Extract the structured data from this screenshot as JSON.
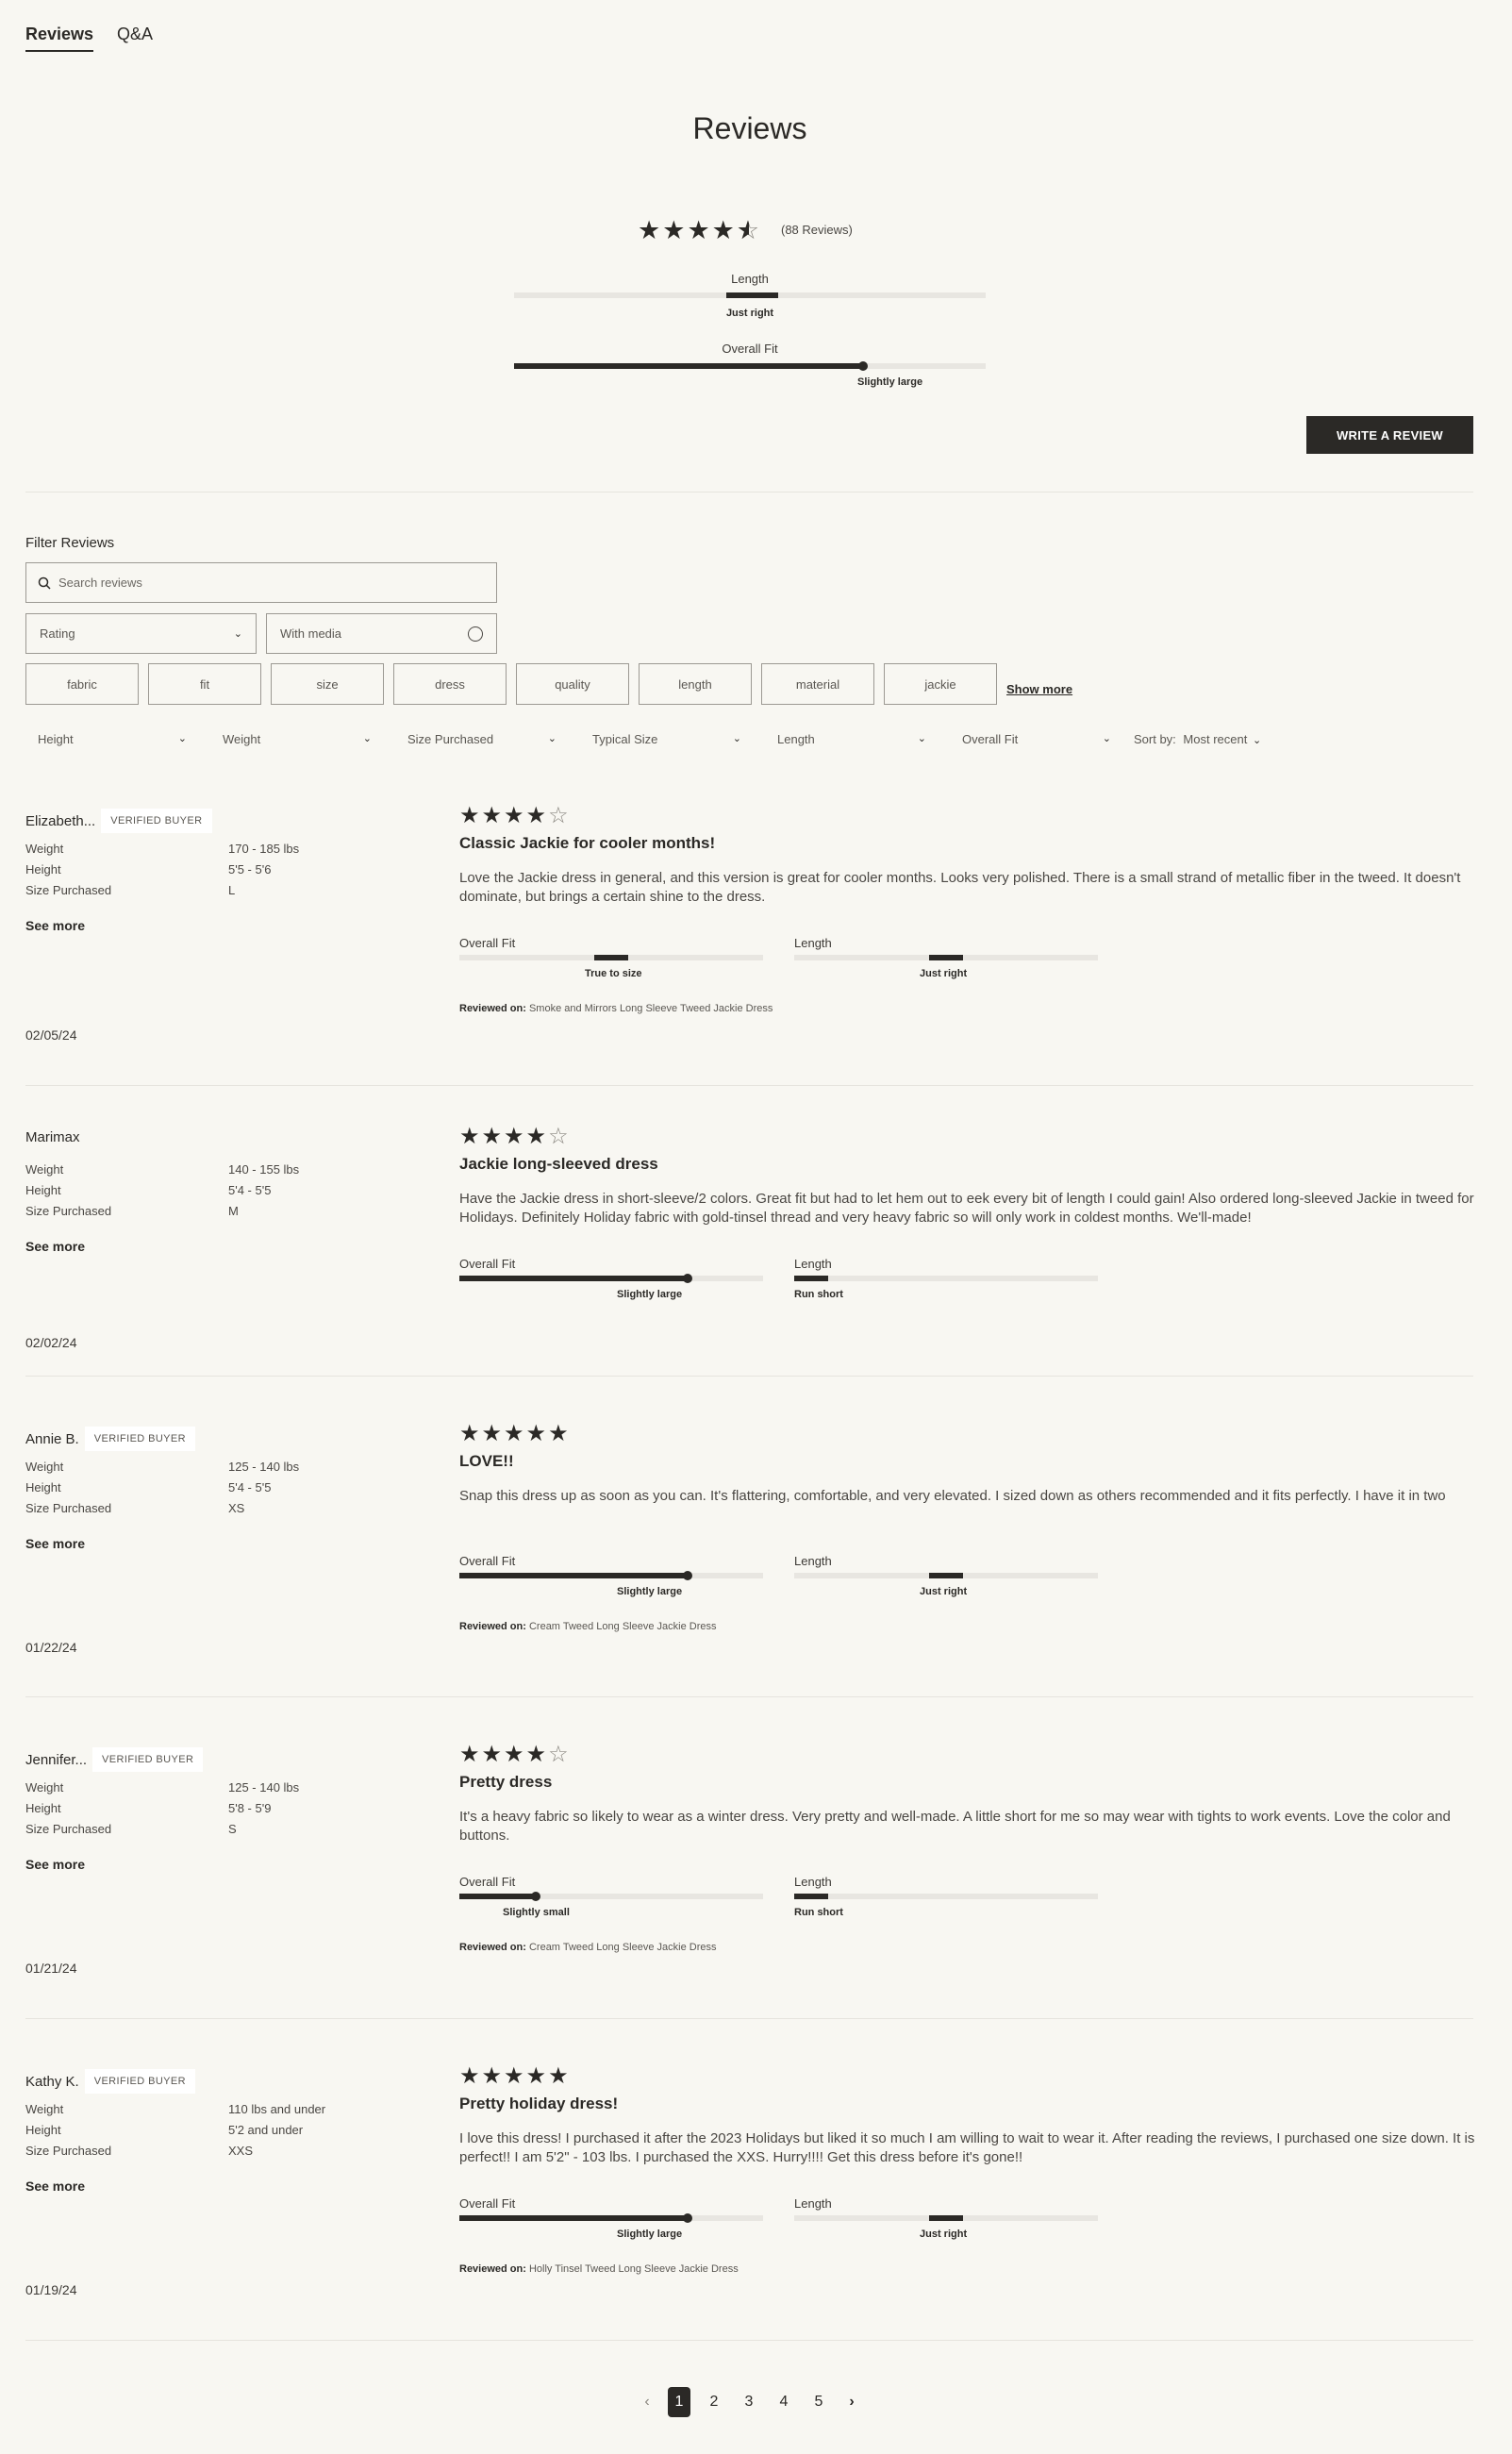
{
  "tabs": [
    {
      "label": "Reviews",
      "active": true
    },
    {
      "label": "Q&A",
      "active": false
    }
  ],
  "page_title": "Reviews",
  "summary": {
    "rating": 4.5,
    "count_label": "(88 Reviews)",
    "length": {
      "label": "Length",
      "value": "Just right",
      "level": 0.5
    },
    "overall_fit": {
      "label": "Overall Fit",
      "value": "Slightly large",
      "level": 0.74
    }
  },
  "write_review_label": "WRITE A REVIEW",
  "filters": {
    "title": "Filter Reviews",
    "search_placeholder": "Search reviews",
    "rating_label": "Rating",
    "media_label": "With media",
    "chips": [
      "fabric",
      "fit",
      "size",
      "dress",
      "quality",
      "length",
      "material",
      "jackie"
    ],
    "show_more": "Show more",
    "dropdowns": [
      "Height",
      "Weight",
      "Size Purchased",
      "Typical Size",
      "Length",
      "Overall Fit"
    ],
    "sort_label": "Sort by:",
    "sort_value": "Most recent"
  },
  "attr_labels": {
    "weight": "Weight",
    "height": "Height",
    "size": "Size Purchased"
  },
  "see_more": "See more",
  "meter_labels": {
    "fit": "Overall Fit",
    "length": "Length"
  },
  "reviewed_on_label": "Reviewed on:",
  "reviews": [
    {
      "name": "Elizabeth...",
      "verified": "VERIFIED BUYER",
      "weight": "170 - 185 lbs",
      "height": "5'5 - 5'6",
      "size": "L",
      "date": "02/05/24",
      "rating": 4,
      "title": "Classic Jackie for cooler months!",
      "body": "Love the Jackie dress in general, and this version is great for cooler months. Looks very polished. There is a small strand of metallic fiber in the tweed. It doesn't dominate, but brings a certain shine to the dress.",
      "fit_value": "True to size",
      "fit_level": 0.5,
      "length_value": "Just right",
      "length_level": 0.5,
      "product": "Smoke and Mirrors Long Sleeve Tweed Jackie Dress"
    },
    {
      "name": "Marimax",
      "verified": "",
      "weight": "140 - 155 lbs",
      "height": "5'4 - 5'5",
      "size": "M",
      "date": "02/02/24",
      "rating": 4,
      "title": "Jackie long-sleeved dress",
      "body": "Have the Jackie dress in short-sleeve/2 colors. Great fit but had to let hem out to eek every bit of length I could gain! Also ordered long-sleeved Jackie in tweed for Holidays. Definitely Holiday fabric with gold-tinsel thread and very heavy fabric so will only work in coldest months. We'll-made!",
      "fit_value": "Slightly large",
      "fit_level": 0.75,
      "length_value": "Run short",
      "length_level": 0,
      "product": ""
    },
    {
      "name": "Annie B.",
      "verified": "VERIFIED BUYER",
      "weight": "125 - 140 lbs",
      "height": "5'4 - 5'5",
      "size": "XS",
      "date": "01/22/24",
      "rating": 5,
      "title": "LOVE!!",
      "body": "Snap this dress up as soon as you can. It's flattering, comfortable, and very elevated. I sized down as others recommended and it fits perfectly. I have it in two",
      "fit_value": "Slightly large",
      "fit_level": 0.75,
      "length_value": "Just right",
      "length_level": 0.5,
      "product": "Cream Tweed Long Sleeve Jackie Dress"
    },
    {
      "name": "Jennifer...",
      "verified": "VERIFIED BUYER",
      "weight": "125 - 140 lbs",
      "height": "5'8 - 5'9",
      "size": "S",
      "date": "01/21/24",
      "rating": 4,
      "title": "Pretty dress",
      "body": "It's a heavy fabric so likely to wear as a winter dress. Very pretty and well-made. A little short for me so may wear with tights to work events. Love the color and buttons.",
      "fit_value": "Slightly small",
      "fit_level": 0.25,
      "length_value": "Run short",
      "length_level": 0,
      "product": "Cream Tweed Long Sleeve Jackie Dress"
    },
    {
      "name": "Kathy K.",
      "verified": "VERIFIED BUYER",
      "weight": "110 lbs and under",
      "height": "5'2 and under",
      "size": "XXS",
      "date": "01/19/24",
      "rating": 5,
      "title": "Pretty holiday dress!",
      "body": "I love this dress! I purchased it after the 2023 Holidays but liked it so much I am willing to wait to wear it. After reading the reviews, I purchased one size down. It is perfect!! I am 5'2\" - 103 lbs. I purchased the XXS. Hurry!!!! Get this dress before it's gone!!",
      "fit_value": "Slightly large",
      "fit_level": 0.75,
      "length_value": "Just right",
      "length_level": 0.5,
      "product": "Holly Tinsel Tweed Long Sleeve Jackie Dress"
    }
  ],
  "pagination": {
    "pages": [
      "1",
      "2",
      "3",
      "4",
      "5"
    ],
    "current": "1",
    "prev": "‹",
    "next": "›"
  }
}
